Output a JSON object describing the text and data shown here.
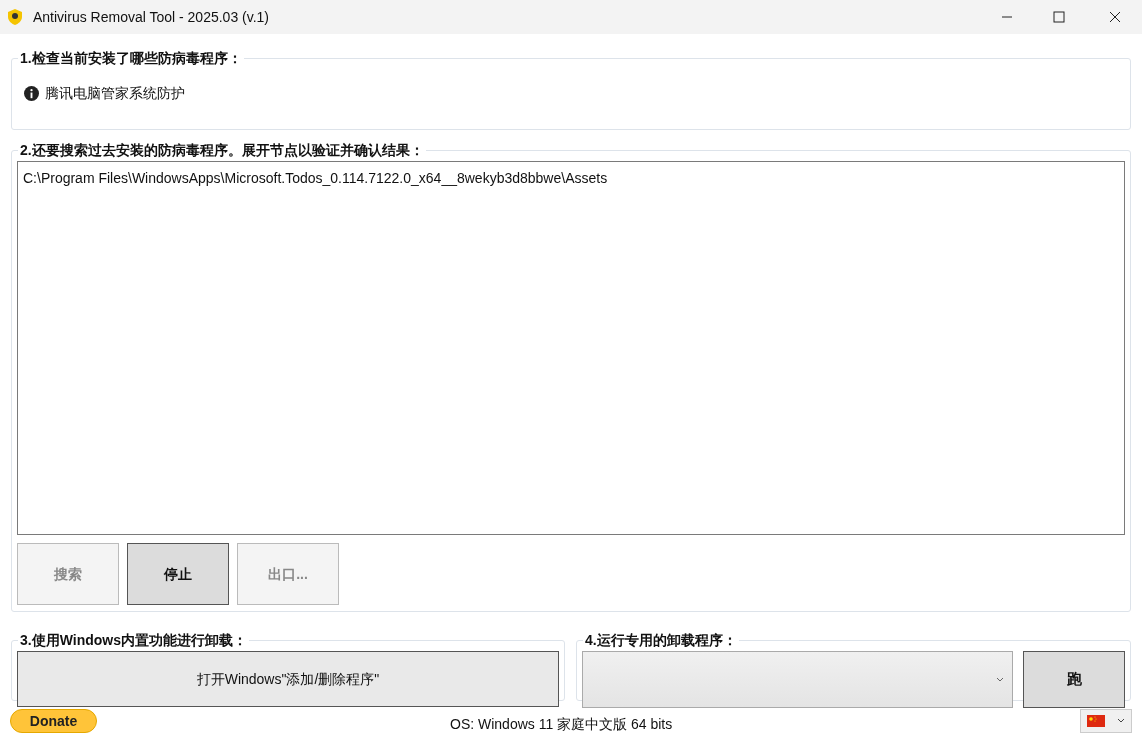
{
  "window": {
    "title": "Antivirus Removal Tool - 2025.03 (v.1)"
  },
  "installed": {
    "legend": "1.检查当前安装了哪些防病毒程序：",
    "items": [
      {
        "kind": "info",
        "label": "腾讯电脑管家系统防护"
      }
    ]
  },
  "past": {
    "legend": "2.还要搜索过去安装的防病毒程序。展开节点以验证并确认结果：",
    "results": [
      "C:\\Program Files\\WindowsApps\\Microsoft.Todos_0.114.7122.0_x64__8wekyb3d8bbwe\\Assets"
    ],
    "buttons": [
      {
        "label": "搜索",
        "disabled": true
      },
      {
        "label": "停止",
        "disabled": false
      },
      {
        "label": "出口...",
        "disabled": true
      }
    ]
  },
  "builtin": {
    "legend": "3.使用Windows内置功能进行卸载：",
    "button": "打开Windows\"添加/删除程序\""
  },
  "dedicated": {
    "legend": "4.运行专用的卸载程序：",
    "run_button": "跑"
  },
  "footer": {
    "donate": "Donate",
    "os": "OS: Windows 11 家庭中文版 64 bits"
  }
}
